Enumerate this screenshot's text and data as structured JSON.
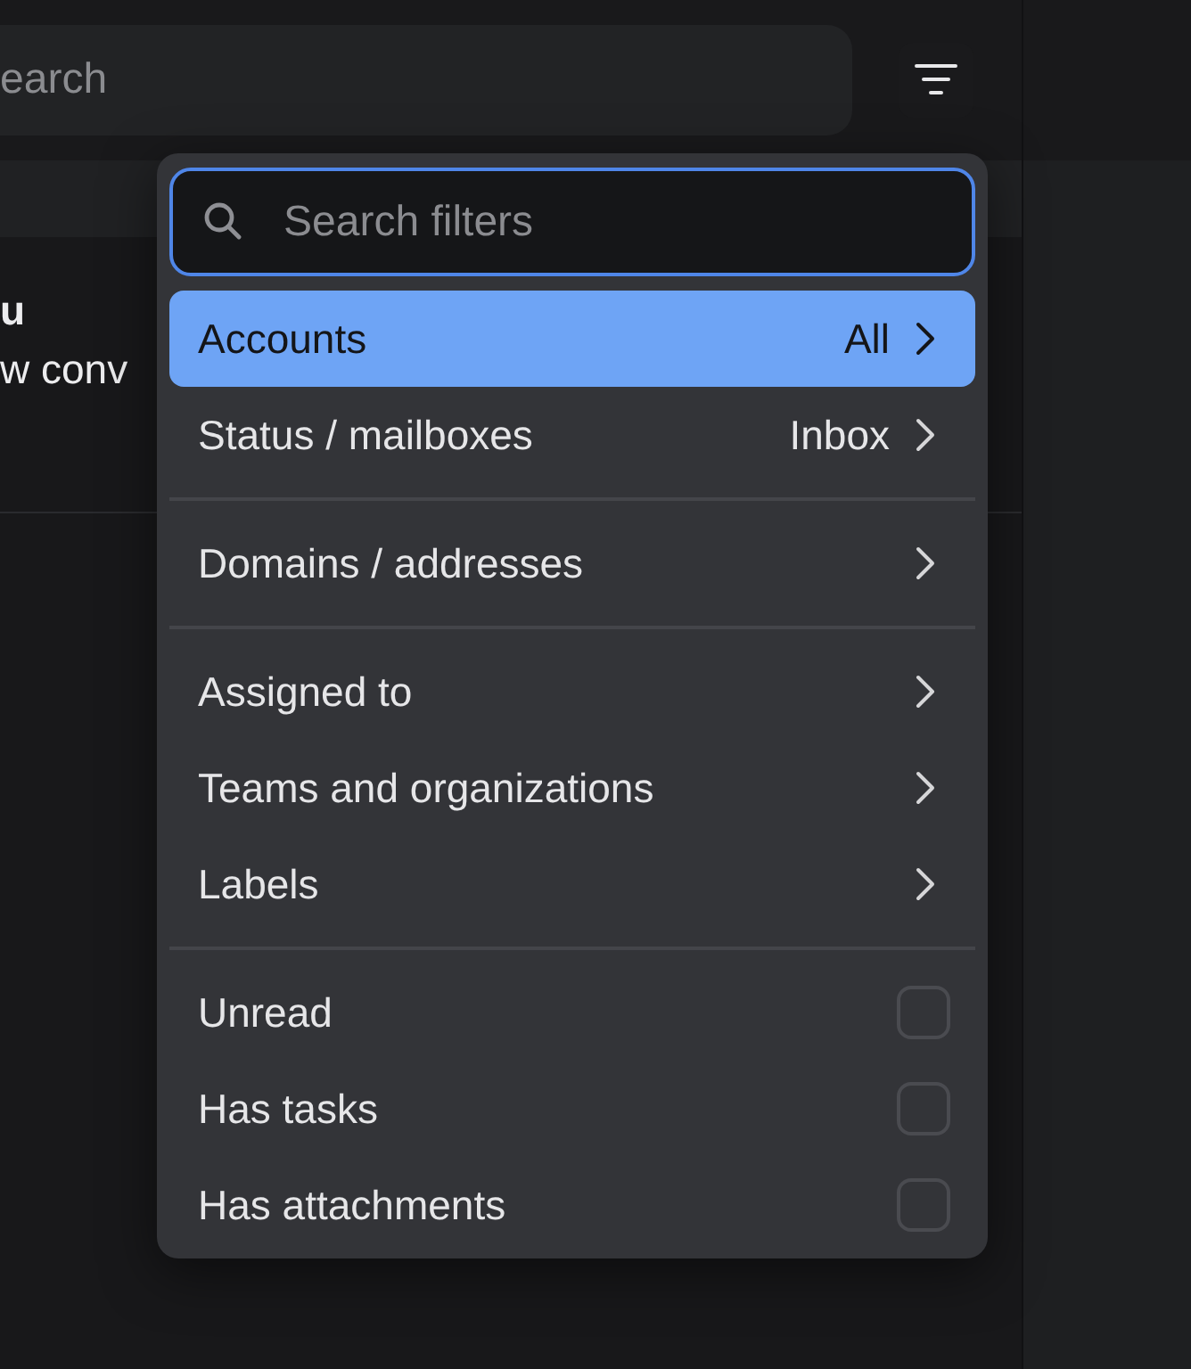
{
  "toolbar": {
    "search": {
      "placeholder": "earch"
    }
  },
  "conversation": {
    "sender": "u",
    "preview": "w conv"
  },
  "filter_menu": {
    "search": {
      "placeholder": "Search filters"
    },
    "groups": [
      [
        {
          "kind": "submenu",
          "label": "Accounts",
          "value": "All",
          "selected": true
        },
        {
          "kind": "submenu",
          "label": "Status / mailboxes",
          "value": "Inbox",
          "selected": false
        }
      ],
      [
        {
          "kind": "submenu",
          "label": "Domains / addresses",
          "selected": false
        }
      ],
      [
        {
          "kind": "submenu",
          "label": "Assigned to",
          "selected": false
        },
        {
          "kind": "submenu",
          "label": "Teams and organizations",
          "selected": false
        },
        {
          "kind": "submenu",
          "label": "Labels",
          "selected": false
        }
      ],
      [
        {
          "kind": "checkbox",
          "label": "Unread",
          "checked": false
        },
        {
          "kind": "checkbox",
          "label": "Has tasks",
          "checked": false
        },
        {
          "kind": "checkbox",
          "label": "Has attachments",
          "checked": false
        }
      ]
    ]
  }
}
